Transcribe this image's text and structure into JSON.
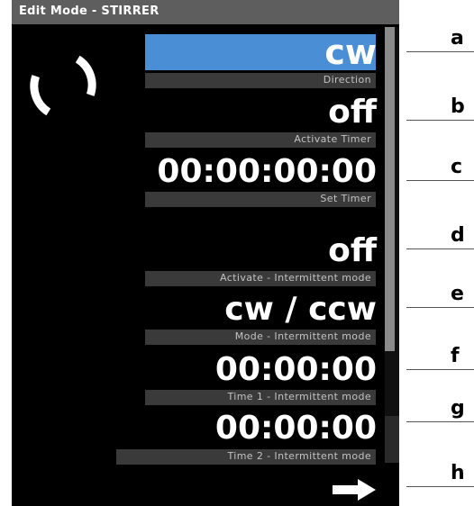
{
  "window": {
    "title": "Edit Mode - STIRRER"
  },
  "settings": [
    {
      "value": "cw",
      "label": "Direction"
    },
    {
      "value": "off",
      "label": "Activate Timer"
    },
    {
      "value": "00:00:00:00",
      "label": "Set Timer"
    },
    {
      "value": "off",
      "label": "Activate  -  Intermittent  mode"
    },
    {
      "value": "cw / ccw",
      "label": "Mode  -  Intermittent  mode"
    },
    {
      "value": "00:00:00",
      "label": "Time  1  -  Intermittent  mode"
    },
    {
      "value": "00:00:00",
      "label": "Time  2  -  Intermittent  mode"
    }
  ],
  "callouts": [
    "a",
    "b",
    "c",
    "d",
    "e",
    "f",
    "g",
    "h"
  ],
  "icons": {
    "status": "refresh-icon",
    "next": "arrow-right-icon"
  },
  "colors": {
    "selected": "#4a8fd6",
    "title_bar": "#5e5e5e",
    "label_bar": "#3a3a3a"
  }
}
